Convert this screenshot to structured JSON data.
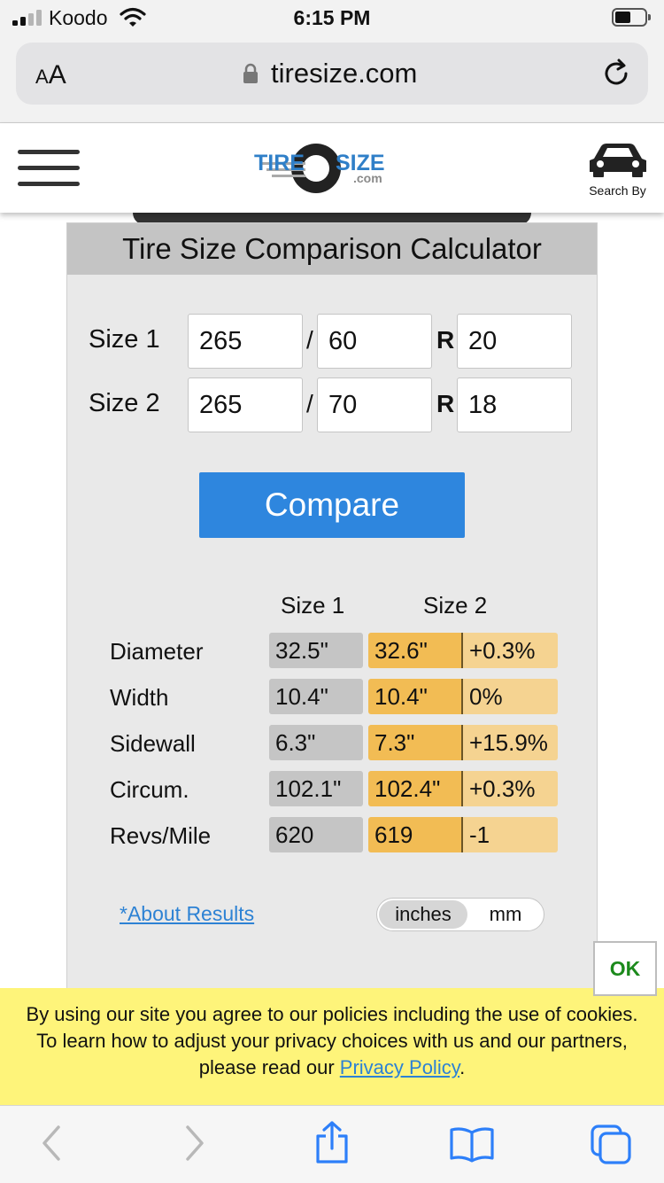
{
  "status_bar": {
    "carrier": "Koodo",
    "time": "6:15 PM"
  },
  "browser": {
    "text_size_big": "A",
    "text_size_small": "A",
    "url": "tiresize.com"
  },
  "header": {
    "search_by_label": "Search By"
  },
  "calculator": {
    "title": "Tire Size Comparison Calculator",
    "inputs": [
      {
        "label": "Size 1",
        "width": "265",
        "aspect": "60",
        "rim": "20"
      },
      {
        "label": "Size 2",
        "width": "265",
        "aspect": "70",
        "rim": "18"
      }
    ],
    "separator_slash": "/",
    "separator_r": "R",
    "compare_label": "Compare",
    "results": {
      "columns": [
        "Size 1",
        "Size 2"
      ],
      "rows": [
        {
          "label": "Diameter",
          "size1": "32.5\"",
          "size2": "32.6\"",
          "diff": "+0.3%"
        },
        {
          "label": "Width",
          "size1": "10.4\"",
          "size2": "10.4\"",
          "diff": "0%"
        },
        {
          "label": "Sidewall",
          "size1": "6.3\"",
          "size2": "7.3\"",
          "diff": "+15.9%"
        },
        {
          "label": "Circum.",
          "size1": "102.1\"",
          "size2": "102.4\"",
          "diff": "+0.3%"
        },
        {
          "label": "Revs/Mile",
          "size1": "620",
          "size2": "619",
          "diff": "-1"
        }
      ]
    },
    "about_link": "*About Results",
    "units": {
      "selected": "inches",
      "other": "mm"
    }
  },
  "cookie_banner": {
    "text": "By using our site you agree to our policies including the use of cookies. To learn how to adjust your privacy choices with us and our partners, please read our ",
    "link": "Privacy Policy",
    "end": ".",
    "ok_label": "OK"
  },
  "colors": {
    "compare_button": "#2e86de",
    "size1_cell": "#c5c5c5",
    "size2_cell": "#f2bc54",
    "diff_cell": "#f5d391",
    "cookie_banner": "#fef47a",
    "link": "#2d82d4",
    "ok_text": "#1c8a1c"
  },
  "icons": [
    "signal-icon",
    "wifi-icon",
    "battery-icon",
    "lock-icon",
    "reload-icon",
    "hamburger-menu-icon",
    "car-icon",
    "back-icon",
    "forward-icon",
    "share-icon",
    "bookmarks-icon",
    "tabs-icon"
  ]
}
